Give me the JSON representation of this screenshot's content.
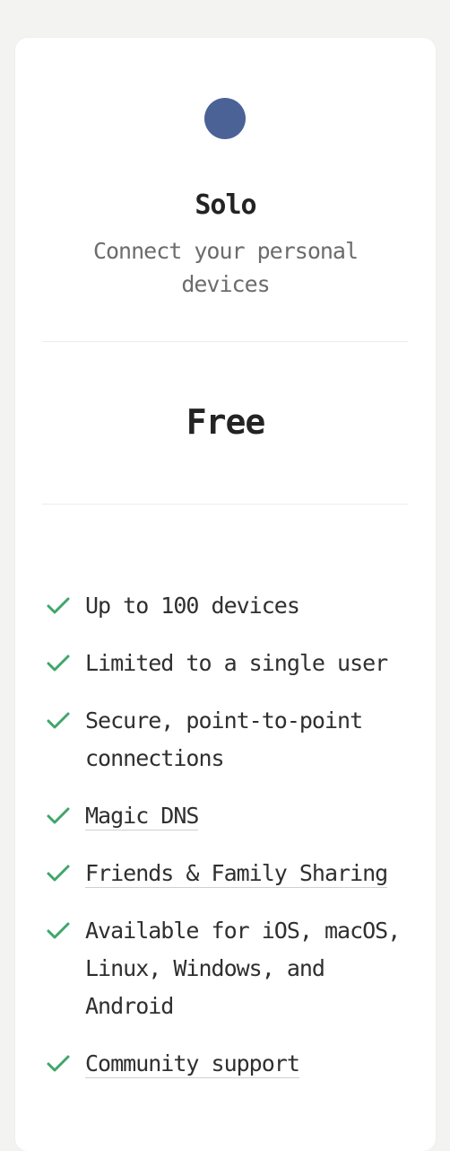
{
  "plan": {
    "name": "Solo",
    "description": "Connect your personal devices",
    "price": "Free",
    "accent_color": "#4a6296",
    "check_color": "#3fa66a"
  },
  "features": [
    {
      "text": "Up to 100 devices",
      "link": false
    },
    {
      "text": "Limited to a single user",
      "link": false
    },
    {
      "text": "Secure, point-to-point connections",
      "link": false
    },
    {
      "text": "Magic DNS",
      "link": true
    },
    {
      "text": "Friends & Family Sharing",
      "link": true
    },
    {
      "text": "Available for iOS, macOS, Linux, Windows, and Android",
      "link": false
    },
    {
      "text": "Community support",
      "link": true
    }
  ]
}
